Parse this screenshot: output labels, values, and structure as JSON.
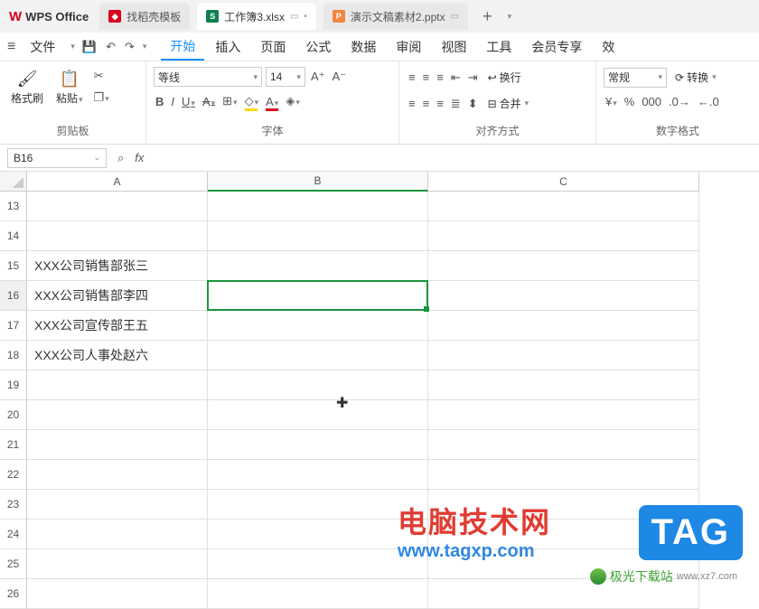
{
  "app": {
    "name": "WPS Office"
  },
  "tabs": [
    {
      "label": "找稻壳模板",
      "type": "red"
    },
    {
      "label": "工作簿3.xlsx",
      "type": "green",
      "active": true
    },
    {
      "label": "演示文稿素材2.pptx",
      "type": "orange"
    }
  ],
  "menu": {
    "file": "文件",
    "items": [
      "开始",
      "插入",
      "页面",
      "公式",
      "数据",
      "审阅",
      "视图",
      "工具",
      "会员专享",
      "效"
    ],
    "active_index": 0
  },
  "ribbon": {
    "clipboard": {
      "format_painter": "格式刷",
      "paste": "粘贴",
      "label": "剪贴板"
    },
    "font": {
      "name": "等线",
      "size": "14",
      "label": "字体"
    },
    "align": {
      "wrap": "换行",
      "merge": "合并",
      "label": "对齐方式"
    },
    "number": {
      "format": "常规",
      "convert": "转换",
      "label": "数字格式"
    }
  },
  "namebox": {
    "ref": "B16"
  },
  "columns": [
    "A",
    "B",
    "C"
  ],
  "rows": [
    "13",
    "14",
    "15",
    "16",
    "17",
    "18",
    "19",
    "20",
    "21",
    "22",
    "23",
    "24",
    "25",
    "26"
  ],
  "cells": {
    "A15": "XXX公司销售部张三",
    "A16": "XXX公司销售部李四",
    "A17": "XXX公司宣传部王五",
    "A18": "XXX公司人事处赵六"
  },
  "selection": {
    "row_index": 3,
    "col": "B"
  },
  "watermarks": {
    "wm1a": "电脑技术网",
    "wm1b": "www.tagxp.com",
    "wm2": "TAG",
    "wm3": "极光下载站",
    "wm3url": "www.xz7.com"
  }
}
